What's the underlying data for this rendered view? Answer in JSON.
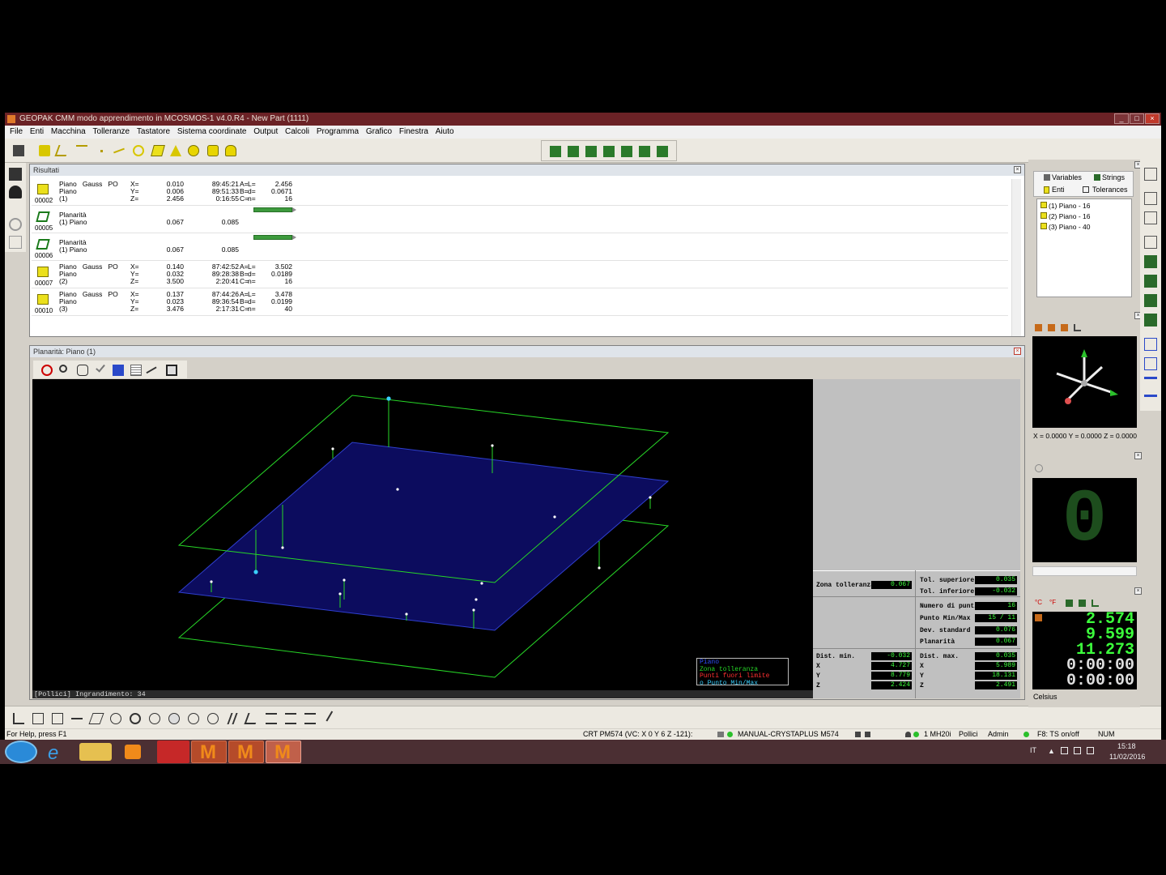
{
  "window": {
    "title": "GEOPAK CMM  modo apprendimento in MCOSMOS-1 v4.0.R4  - New Part (1111)"
  },
  "menu": [
    "File",
    "Enti",
    "Macchina",
    "Tolleranze",
    "Tastatore",
    "Sistema coordinate",
    "Output",
    "Calcoli",
    "Programma",
    "Grafico",
    "Finestra",
    "Aiuto"
  ],
  "results": {
    "title": "Risultati",
    "rows": [
      {
        "id": "00002",
        "type": "plane",
        "l1": "Piano   Gauss   PO",
        "l2": "Piano",
        "l3": "(1)",
        "x": "X=",
        "y": "Y=",
        "z": "Z=",
        "xv": "0.010",
        "yv": "0.006",
        "zv": "2.456",
        "a": "A=",
        "b": "B=",
        "c": "C=",
        "av": "89:45:21",
        "bv": "89:51:33",
        "cv": "0:16:55",
        "l": "L=",
        "d": "d=",
        "n": "n=",
        "lv": "2.456",
        "dv": "0.0671",
        "nv": "16"
      },
      {
        "id": "00005",
        "type": "flat",
        "l1": "Planarità",
        "l2": "(1) Piano",
        "v1": "0.067",
        "v2": "0.085"
      },
      {
        "id": "00006",
        "type": "flat",
        "l1": "Planarità",
        "l2": "(1) Piano",
        "v1": "0.067",
        "v2": "0.085"
      },
      {
        "id": "00007",
        "type": "plane",
        "l1": "Piano   Gauss   PO",
        "l2": "Piano",
        "l3": "(2)",
        "x": "X=",
        "y": "Y=",
        "z": "Z=",
        "xv": "0.140",
        "yv": "0.032",
        "zv": "3.500",
        "a": "A=",
        "b": "B=",
        "c": "C=",
        "av": "87:42:52",
        "bv": "89:28:38",
        "cv": "2:20:41",
        "l": "L=",
        "d": "d=",
        "n": "n=",
        "lv": "3.502",
        "dv": "0.0189",
        "nv": "16"
      },
      {
        "id": "00010",
        "type": "plane",
        "l1": "Piano   Gauss   PO",
        "l2": "Piano",
        "l3": "(3)",
        "x": "X=",
        "y": "Y=",
        "z": "Z=",
        "xv": "0.137",
        "yv": "0.023",
        "zv": "3.476",
        "a": "A=",
        "b": "B=",
        "c": "C=",
        "av": "87:44:26",
        "bv": "89:36:54",
        "cv": "2:17:31",
        "l": "L=",
        "d": "d=",
        "n": "n=",
        "lv": "3.478",
        "dv": "0.0199",
        "nv": "40"
      }
    ]
  },
  "flatness_window": {
    "title": "Planarità: Piano (1)",
    "graph_status": "[Pollici] Ingrandimento:  34",
    "legend": [
      "Piano",
      "Zona tolleranza",
      "Punti fuori limite",
      "o Punto Min/Max"
    ],
    "info": {
      "zona_label": "Zona tolleranza",
      "zona_value": "0.067",
      "tol_sup_label": "Tol. superiore",
      "tol_sup_value": "0.035",
      "tol_inf_label": "Tol. inferiore",
      "tol_inf_value": "-0.032",
      "num_punti_label": "Numero di punti",
      "num_punti_value": "16",
      "punto_minmax_label": "Punto Min/Max",
      "punto_minmax_value": "15 / 11",
      "dev_std_label": "Dev. standard *",
      "dev_std_value": "0.076",
      "planarita_label": "Planarità",
      "planarita_value": "0.067",
      "dist_min_label": "Dist. min.",
      "dist_min": {
        "value": "-0.032",
        "x": "4.727",
        "y": "8.779",
        "z": "2.424"
      },
      "dist_max_label": "Dist. max.",
      "dist_max": {
        "value": "0.035",
        "x": "5.989",
        "y": "18.131",
        "z": "2.491"
      },
      "x_label": "X",
      "y_label": "Y",
      "z_label": "Z"
    }
  },
  "side": {
    "tabs": [
      "Variables",
      "Strings",
      "Enti",
      "Tolerances"
    ],
    "items": [
      "(1) Piano - 16",
      "(2) Piano - 16",
      "(3) Piano - 40"
    ],
    "coords": "X = 0.0000 Y = 0.0000 Z = 0.0000",
    "counter_digit": "0",
    "readout": [
      "2.574",
      "9.599",
      "11.273",
      "0:00:00",
      "0:00:00"
    ],
    "temp_label": "Celsius"
  },
  "status": {
    "help": "For Help, press F1",
    "crt": "CRT PM574 (VC: X 0 Y 6 Z -121):",
    "machine": "MANUAL-CRYSTAPLUS M574",
    "probe": "1 MH20i",
    "units": "Pollici",
    "user": "Admin",
    "f8": "F8: TS on/off",
    "num": "NUM"
  },
  "taskbar": {
    "lang": "IT",
    "time": "15:18",
    "date": "11/02/2016"
  },
  "colors": {
    "title_bg": "#6b2226",
    "plane_fill": "#0c0c5e",
    "plane_edge": "#2f3fcf",
    "tol_zone": "#27d727",
    "readout_green": "#3cff3c"
  }
}
